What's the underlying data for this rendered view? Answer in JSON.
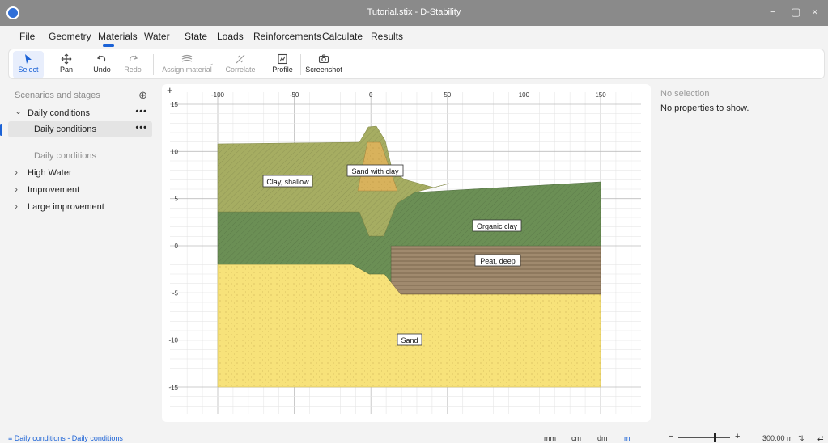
{
  "window": {
    "title": "Tutorial.stix - D-Stability",
    "minimize": "−",
    "maximize": "▢",
    "close": "×"
  },
  "menu": [
    "File",
    "Geometry",
    "Materials",
    "Water",
    "State",
    "Loads",
    "Reinforcements",
    "Calculate",
    "Results"
  ],
  "active_menu": "Materials",
  "toolbar": {
    "select": "Select",
    "pan": "Pan",
    "undo": "Undo",
    "redo": "Redo",
    "assign_material": "Assign material",
    "correlate": "Correlate",
    "profile": "Profile",
    "screenshot": "Screenshot"
  },
  "scenarios": {
    "header": "Scenarios and stages",
    "add_icon": "⊕",
    "items": [
      {
        "label": "Daily conditions",
        "toggle": "⌄",
        "menu": "•••"
      },
      {
        "label": "Daily conditions",
        "menu": "•••"
      },
      {
        "label": "Daily conditions"
      },
      {
        "label": "High Water",
        "toggle": "›"
      },
      {
        "label": "Improvement",
        "toggle": "›"
      },
      {
        "label": "Large improvement",
        "toggle": "›"
      }
    ]
  },
  "canvas": {
    "corner": "+",
    "x_ticks": [
      "-100",
      "-50",
      "0",
      "50",
      "100",
      "150"
    ],
    "y_ticks": [
      "15",
      "10",
      "5",
      "0",
      "-5",
      "-10",
      "-15"
    ],
    "layers": [
      {
        "name": "Sand",
        "color": "#f7e27a"
      },
      {
        "name": "Peat, deep",
        "color": "#a08a6e"
      },
      {
        "name": "Organic clay",
        "color": "#6b8f55"
      },
      {
        "name": "Clay, shallow",
        "color": "#a6ad62"
      },
      {
        "name": "Sand with clay",
        "color": "#d8b25c"
      }
    ]
  },
  "properties": {
    "title": "No selection",
    "message": "No properties to show."
  },
  "status": {
    "stage": "Daily conditions - Daily conditions",
    "units": [
      "mm",
      "cm",
      "dm",
      "m"
    ],
    "active_unit": "m",
    "zoom_minus": "−",
    "zoom_plus": "+",
    "zoom": "300.00 m"
  },
  "colors": {
    "accent": "#1b62d6",
    "titlebar": "#8a8a8a"
  }
}
